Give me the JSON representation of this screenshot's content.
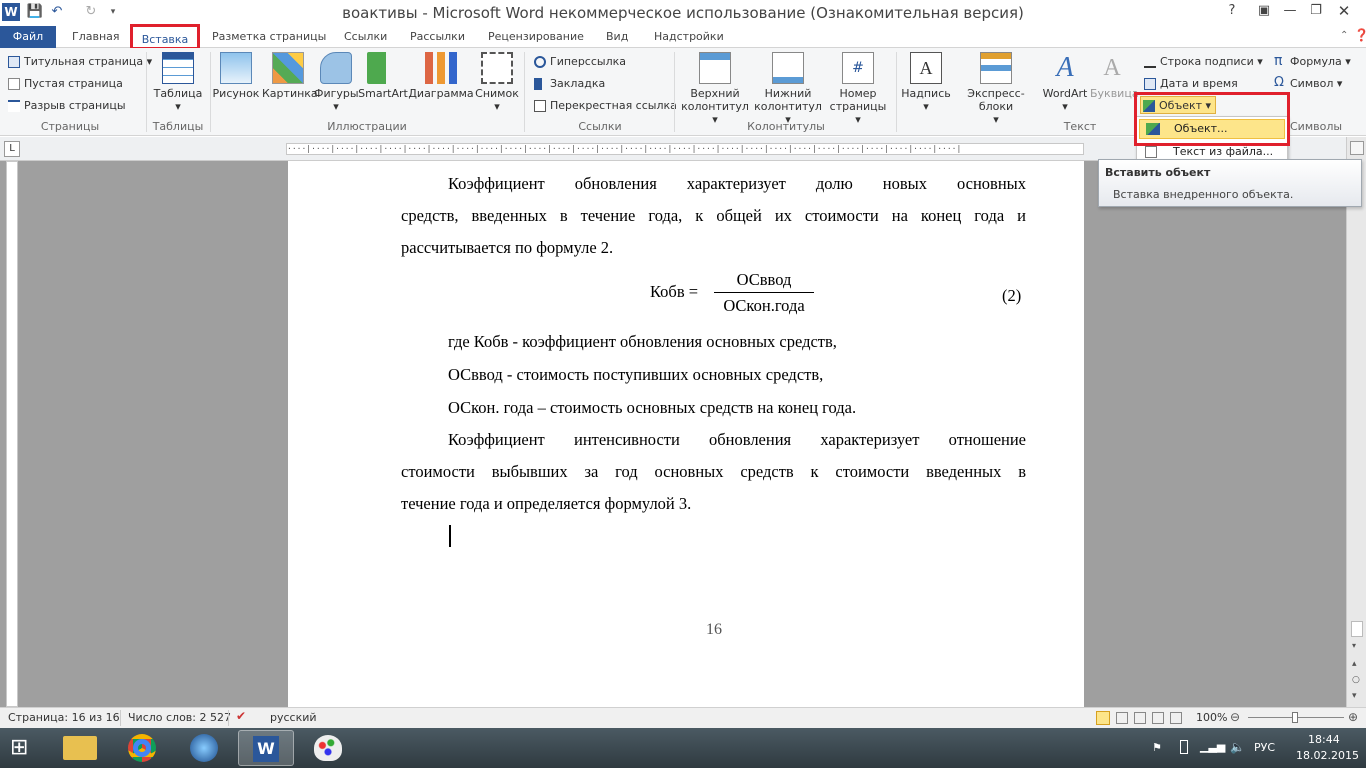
{
  "window": {
    "title": "воактивы - Microsoft Word некоммерческое использование (Ознакомительная версия)"
  },
  "tabs": [
    {
      "label": "Файл"
    },
    {
      "label": "Главная"
    },
    {
      "label": "Вставка"
    },
    {
      "label": "Разметка страницы"
    },
    {
      "label": "Ссылки"
    },
    {
      "label": "Рассылки"
    },
    {
      "label": "Рецензирование"
    },
    {
      "label": "Вид"
    },
    {
      "label": "Надстройки"
    }
  ],
  "ribbon": {
    "pages": {
      "label": "Страницы",
      "items": [
        "Титульная страница",
        "Пустая страница",
        "Разрыв страницы"
      ]
    },
    "tables": {
      "label": "Таблицы",
      "button": "Таблица"
    },
    "illustrations": {
      "label": "Иллюстрации",
      "buttons": [
        "Рисунок",
        "Картинка",
        "Фигуры",
        "SmartArt",
        "Диаграмма",
        "Снимок"
      ]
    },
    "links": {
      "label": "Ссылки",
      "items": [
        "Гиперссылка",
        "Закладка",
        "Перекрестная ссылка"
      ]
    },
    "headers": {
      "label": "Колонтитулы",
      "buttons": [
        {
          "line1": "Верхний",
          "line2": "колонтитул"
        },
        {
          "line1": "Нижний",
          "line2": "колонтитул"
        },
        {
          "line1": "Номер",
          "line2": "страницы"
        }
      ]
    },
    "text": {
      "label": "Текст",
      "buttons": [
        "Надпись",
        "Экспресс-блоки",
        "WordArt",
        "Буквица"
      ],
      "items": [
        "Строка подписи",
        "Дата и время",
        "Объект"
      ]
    },
    "symbols": {
      "label": "Символы",
      "items": [
        "Формула",
        "Символ"
      ]
    }
  },
  "dropdown": {
    "items": [
      "Объект...",
      "Текст из файла..."
    ]
  },
  "tooltip": {
    "title": "Вставить объект",
    "body": "Вставка внедренного объекта."
  },
  "document": {
    "p1": [
      "Коэффициент обновления характеризует долю новых основных",
      "средств, введенных в течение года, к общей их стоимости на конец года и",
      "рассчитывается по формуле 2."
    ],
    "formula": {
      "lhs": "Кобв =",
      "num": "ОСввод",
      "den": "ОСкон.года",
      "no": "(2)"
    },
    "defs": [
      "где Кобв - коэффициент обновления основных средств,",
      "ОСввод - стоимость поступивших основных средств,",
      "ОСкон. года – стоимость основных средств на конец года."
    ],
    "p2": [
      "Коэффициент интенсивности обновления характеризует отношение",
      "стоимости выбывших за год основных средств к стоимости введенных в",
      "течение года и определяется формулой 3."
    ],
    "page_number": "16"
  },
  "status": {
    "page": "Страница: 16 из 16",
    "words": "Число слов: 2 527",
    "lang": "русский",
    "zoom": "100%"
  },
  "taskbar": {
    "lang": "РУС",
    "time": "18:44",
    "date": "18.02.2015"
  },
  "colors": {
    "accent": "#2b579a",
    "highlight": "#e0202c",
    "hover": "#fde58a"
  }
}
